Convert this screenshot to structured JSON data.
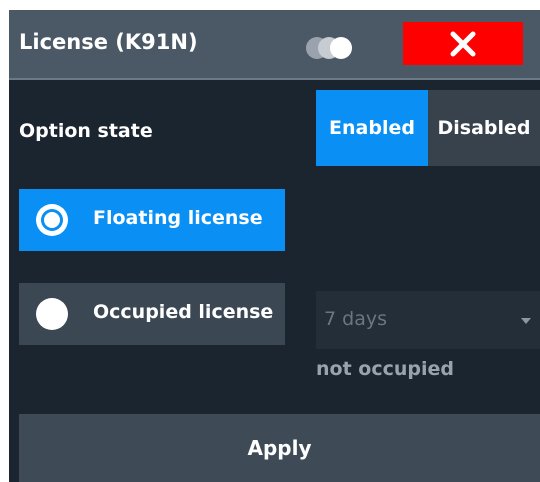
{
  "dialog": {
    "title": "License (K91N)",
    "close_icon": "close-x-icon",
    "toggle_icon": "display-toggle-icon"
  },
  "option_state": {
    "label": "Option state",
    "enabled_label": "Enabled",
    "disabled_label": "Disabled",
    "selected": "Enabled"
  },
  "license_type": {
    "floating_label": "Floating license",
    "occupied_label": "Occupied license",
    "selected": "Floating license"
  },
  "occupied_duration": {
    "value": "7 days",
    "status": "not occupied"
  },
  "apply_label": "Apply",
  "colors": {
    "background": "#1b2530",
    "titlebar": "#4b5967",
    "accent": "#0a8ff5",
    "close": "#fe0000"
  }
}
